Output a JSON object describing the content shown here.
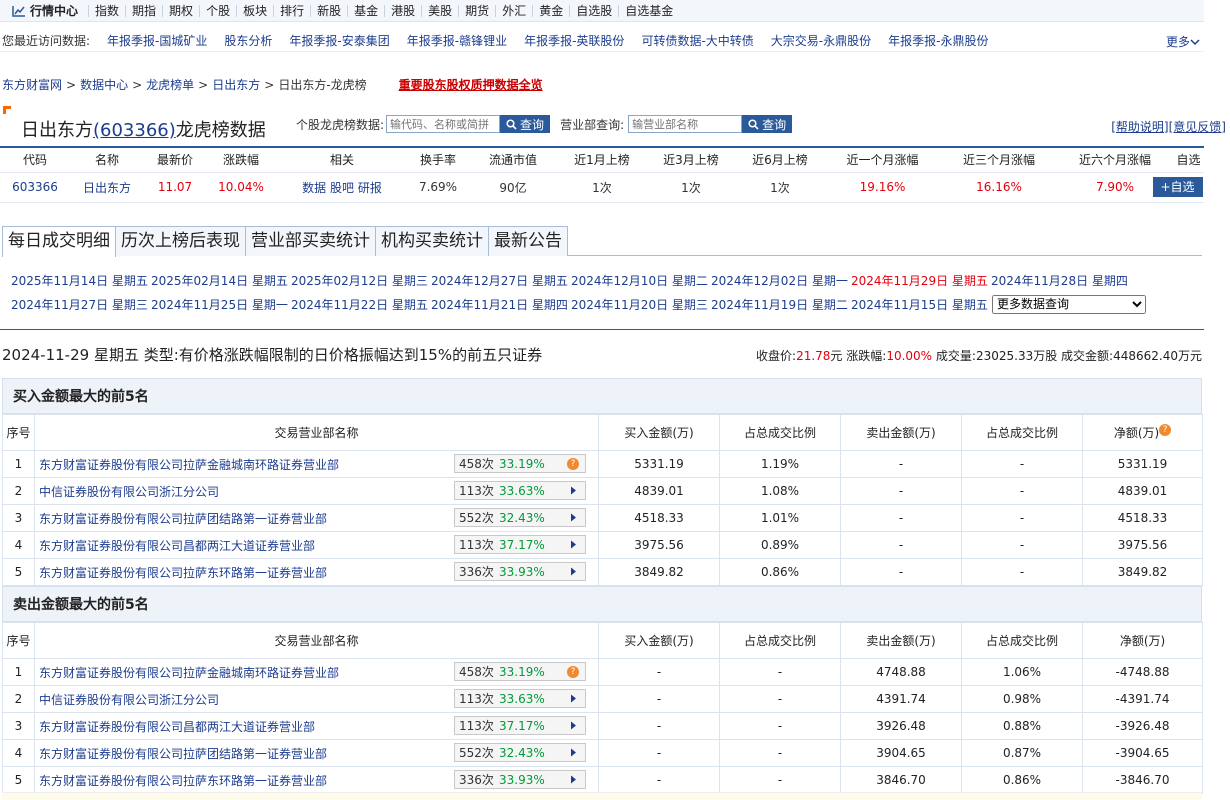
{
  "topnav": {
    "brand": "行情中心",
    "links": [
      "指数",
      "期指",
      "期权",
      "个股",
      "板块",
      "排行",
      "新股",
      "基金",
      "港股",
      "美股",
      "期货",
      "外汇",
      "黄金",
      "自选股",
      "自选基金"
    ]
  },
  "recent": {
    "label": "您最近访问数据:",
    "items": [
      "年报季报-国城矿业",
      "股东分析",
      "年报季报-安泰集团",
      "年报季报-赣锋锂业",
      "年报季报-英联股份",
      "可转债数据-大中转债",
      "大宗交易-永鼎股份",
      "年报季报-永鼎股份"
    ],
    "more": "更多"
  },
  "breadcrumb": {
    "items": [
      "东方财富网",
      "数据中心",
      "龙虎榜单",
      "日出东方"
    ],
    "current": "日出东方-龙虎榜",
    "hot": "重要股东股权质押数据全览"
  },
  "header": {
    "name": "日出东方",
    "code": "(603366)",
    "suffix": "龙虎榜数据",
    "search_label": "个股龙虎榜数据:",
    "search_placeholder": "输代码、名称或简拼",
    "search_button": "查询",
    "dept_label": "营业部查询:",
    "dept_placeholder": "输营业部名称",
    "dept_button": "查询",
    "help": "[帮助说明]",
    "feedback": "[意见反馈]"
  },
  "info_table": {
    "headers": [
      "代码",
      "名称",
      "最新价",
      "涨跌幅",
      "相关",
      "换手率",
      "流通市值",
      "近1月上榜",
      "近3月上榜",
      "近6月上榜",
      "近一个月涨幅",
      "近三个月涨幅",
      "近六个月涨幅",
      "自选"
    ],
    "row": {
      "code": "603366",
      "name": "日出东方",
      "price": "11.07",
      "change": "10.04%",
      "related": [
        "数据",
        "股吧",
        "研报"
      ],
      "turnover": "7.69%",
      "mktcap": "90亿",
      "m1": "1次",
      "m3": "1次",
      "m6": "1次",
      "r1": "19.16%",
      "r3": "16.16%",
      "r6": "7.90%",
      "add": "+自选"
    }
  },
  "tabs": [
    "每日成交明细",
    "历次上榜后表现",
    "营业部买卖统计",
    "机构买卖统计",
    "最新公告"
  ],
  "dates": {
    "row1": [
      "2025年11月14日 星期五",
      "2025年02月14日 星期五",
      "2025年02月12日 星期三",
      "2024年12月27日 星期五",
      "2024年12月10日 星期二",
      "2024年12月02日 星期一",
      "2024年11月29日 星期五",
      "2024年11月28日 星期四"
    ],
    "row2": [
      "2024年11月27日 星期三",
      "2024年11月25日 星期一",
      "2024年11月22日 星期五",
      "2024年11月21日 星期四",
      "2024年11月20日 星期三",
      "2024年11月19日 星期二",
      "2024年11月15日 星期五"
    ],
    "select": "更多数据查询"
  },
  "summary": {
    "title": "2024-11-29 星期五 类型:有价格涨跌幅限制的日价格振幅达到15%的前五只证券",
    "close_label": "收盘价:",
    "close": "21.78",
    "unit_yuan": "元",
    "chg_label": "涨跌幅:",
    "chg": "10.00%",
    "vol_label": "成交量:",
    "vol": "23025.33万股",
    "amt_label": "成交金额:",
    "amt": "448662.40万元"
  },
  "buy_section": {
    "title": "买入金额最大的前5名",
    "headers": [
      "序号",
      "交易营业部名称",
      "买入金额(万)",
      "占总成交比例",
      "卖出金额(万)",
      "占总成交比例",
      "净额(万)"
    ],
    "rows": [
      {
        "idx": "1",
        "name": "东方财富证券股份有限公司拉萨金融城南环路证券营业部",
        "times": "458次",
        "pct": "33.19%",
        "icon": "question",
        "buy": "5331.19",
        "buy_ratio": "1.19%",
        "sell": "-",
        "sell_ratio": "-",
        "net": "5331.19"
      },
      {
        "idx": "2",
        "name": "中信证券股份有限公司浙江分公司",
        "times": "113次",
        "pct": "33.63%",
        "icon": "arrow",
        "buy": "4839.01",
        "buy_ratio": "1.08%",
        "sell": "-",
        "sell_ratio": "-",
        "net": "4839.01"
      },
      {
        "idx": "3",
        "name": "东方财富证券股份有限公司拉萨团结路第一证券营业部",
        "times": "552次",
        "pct": "32.43%",
        "icon": "arrow",
        "buy": "4518.33",
        "buy_ratio": "1.01%",
        "sell": "-",
        "sell_ratio": "-",
        "net": "4518.33"
      },
      {
        "idx": "4",
        "name": "东方财富证券股份有限公司昌都两江大道证券营业部",
        "times": "113次",
        "pct": "37.17%",
        "icon": "arrow",
        "buy": "3975.56",
        "buy_ratio": "0.89%",
        "sell": "-",
        "sell_ratio": "-",
        "net": "3975.56"
      },
      {
        "idx": "5",
        "name": "东方财富证券股份有限公司拉萨东环路第一证券营业部",
        "times": "336次",
        "pct": "33.93%",
        "icon": "arrow",
        "buy": "3849.82",
        "buy_ratio": "0.86%",
        "sell": "-",
        "sell_ratio": "-",
        "net": "3849.82"
      }
    ]
  },
  "sell_section": {
    "title": "卖出金额最大的前5名",
    "headers": [
      "序号",
      "交易营业部名称",
      "买入金额(万)",
      "占总成交比例",
      "卖出金额(万)",
      "占总成交比例",
      "净额(万)"
    ],
    "rows": [
      {
        "idx": "1",
        "name": "东方财富证券股份有限公司拉萨金融城南环路证券营业部",
        "times": "458次",
        "pct": "33.19%",
        "icon": "question",
        "buy": "-",
        "buy_ratio": "-",
        "sell": "4748.88",
        "sell_ratio": "1.06%",
        "net": "-4748.88"
      },
      {
        "idx": "2",
        "name": "中信证券股份有限公司浙江分公司",
        "times": "113次",
        "pct": "33.63%",
        "icon": "arrow",
        "buy": "-",
        "buy_ratio": "-",
        "sell": "4391.74",
        "sell_ratio": "0.98%",
        "net": "-4391.74"
      },
      {
        "idx": "3",
        "name": "东方财富证券股份有限公司昌都两江大道证券营业部",
        "times": "113次",
        "pct": "37.17%",
        "icon": "arrow",
        "buy": "-",
        "buy_ratio": "-",
        "sell": "3926.48",
        "sell_ratio": "0.88%",
        "net": "-3926.48"
      },
      {
        "idx": "4",
        "name": "东方财富证券股份有限公司拉萨团结路第一证券营业部",
        "times": "552次",
        "pct": "32.43%",
        "icon": "arrow",
        "buy": "-",
        "buy_ratio": "-",
        "sell": "3904.65",
        "sell_ratio": "0.87%",
        "net": "-3904.65"
      },
      {
        "idx": "5",
        "name": "东方财富证券股份有限公司拉萨东环路第一证券营业部",
        "times": "336次",
        "pct": "33.93%",
        "icon": "arrow",
        "buy": "-",
        "buy_ratio": "-",
        "sell": "3846.70",
        "sell_ratio": "0.86%",
        "net": "-3846.70"
      }
    ]
  },
  "colors": {
    "up": "#e3000f",
    "down": "#009a37",
    "accent": "#2a5a9a",
    "link": "#1c3d8e"
  }
}
